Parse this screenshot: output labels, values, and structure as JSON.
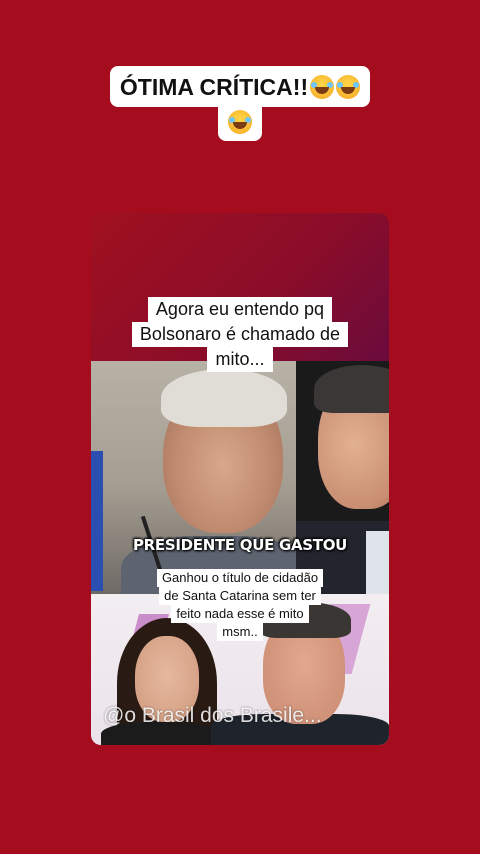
{
  "post": {
    "caption_line1": "ÓTIMA CRÍTICA!!",
    "caption_emojis_line1": [
      "rolling-on-floor-laughing",
      "rolling-on-floor-laughing"
    ],
    "caption_emojis_line2": [
      "rolling-on-floor-laughing"
    ]
  },
  "video": {
    "top_text": [
      "Agora eu entendo pq",
      "Bolsonaro é chamado de",
      "mito..."
    ],
    "presidente_label": "PRESIDENTE QUE GASTOU",
    "ganhou_text": [
      "Ganhou o título de cidadão",
      "de Santa Catarina sem ter",
      "feito nada esse é mito",
      "msm.."
    ],
    "watermark": "@o Brasil dos Brasile..."
  },
  "colors": {
    "background": "#a50c1d",
    "caption_bg": "#ffffff"
  }
}
